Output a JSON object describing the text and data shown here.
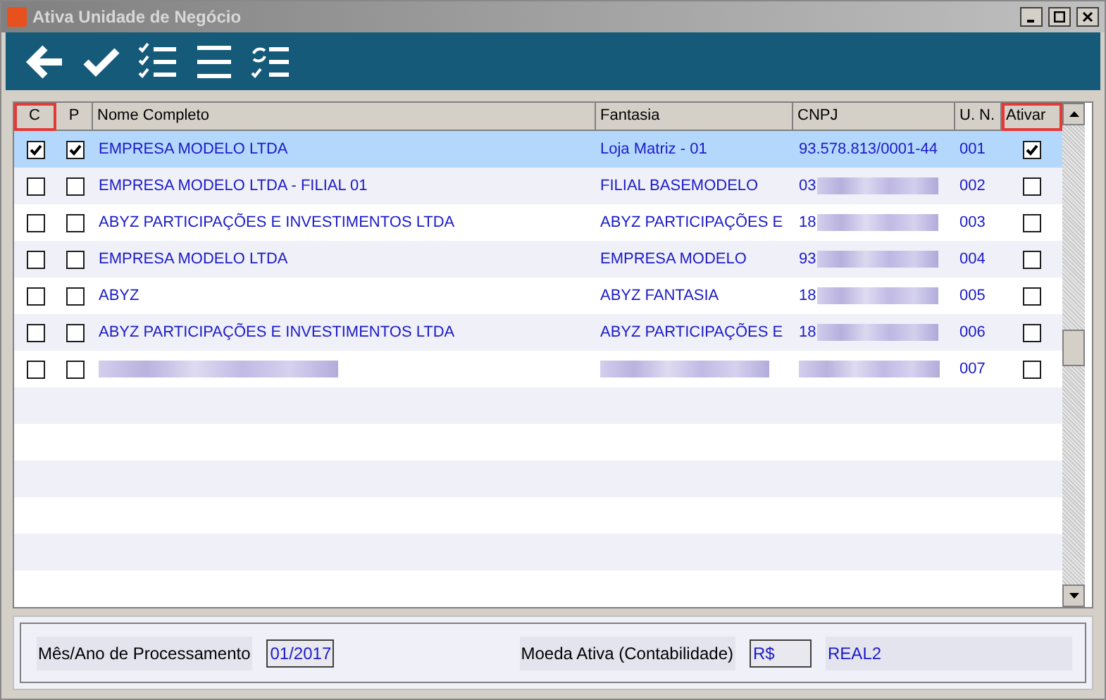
{
  "window": {
    "title": "Ativa Unidade de Negócio"
  },
  "table": {
    "columns": [
      {
        "label": "C",
        "highlighted": true
      },
      {
        "label": "P",
        "highlighted": false
      },
      {
        "label": "Nome Completo",
        "highlighted": false
      },
      {
        "label": "Fantasia",
        "highlighted": false
      },
      {
        "label": "CNPJ",
        "highlighted": false
      },
      {
        "label": "U. N.",
        "highlighted": false
      },
      {
        "label": "Ativar",
        "highlighted": true
      }
    ],
    "rows": [
      {
        "selected": true,
        "c_checked": true,
        "p_checked": true,
        "name": "EMPRESA MODELO LTDA",
        "fantasia": "Loja Matriz - 01",
        "cnpj": "93.578.813/0001-44",
        "cnpj_redacted": false,
        "un": "001",
        "ativar_checked": true
      },
      {
        "selected": false,
        "c_checked": false,
        "p_checked": false,
        "name": "EMPRESA MODELO LTDA - FILIAL 01",
        "fantasia": "FILIAL BASEMODELO",
        "cnpj": "03",
        "cnpj_redacted": true,
        "un": "002",
        "ativar_checked": false
      },
      {
        "selected": false,
        "c_checked": false,
        "p_checked": false,
        "name": "ABYZ PARTICIPAÇÕES E INVESTIMENTOS LTDA",
        "fantasia": "ABYZ PARTICIPAÇÕES E",
        "cnpj": "18",
        "cnpj_redacted": true,
        "un": "003",
        "ativar_checked": false
      },
      {
        "selected": false,
        "c_checked": false,
        "p_checked": false,
        "name": "EMPRESA MODELO LTDA",
        "fantasia": "EMPRESA MODELO",
        "cnpj": "93",
        "cnpj_redacted": true,
        "un": "004",
        "ativar_checked": false
      },
      {
        "selected": false,
        "c_checked": false,
        "p_checked": false,
        "name": "ABYZ",
        "fantasia": "ABYZ FANTASIA",
        "cnpj": "18",
        "cnpj_redacted": true,
        "un": "005",
        "ativar_checked": false
      },
      {
        "selected": false,
        "c_checked": false,
        "p_checked": false,
        "name": "ABYZ PARTICIPAÇÕES E INVESTIMENTOS LTDA",
        "fantasia": "ABYZ PARTICIPAÇÕES E",
        "cnpj": "18",
        "cnpj_redacted": true,
        "un": "006",
        "ativar_checked": false
      },
      {
        "selected": false,
        "c_checked": false,
        "p_checked": false,
        "name_redacted": true,
        "fantasia_redacted": true,
        "cnpj_redacted": true,
        "un": "007",
        "ativar_checked": false
      }
    ]
  },
  "footer": {
    "period_label": "Mês/Ano de Processamento",
    "period_value": "01/2017",
    "currency_label": "Moeda Ativa (Contabilidade)",
    "currency_code": "R$",
    "currency_name": "REAL2"
  }
}
